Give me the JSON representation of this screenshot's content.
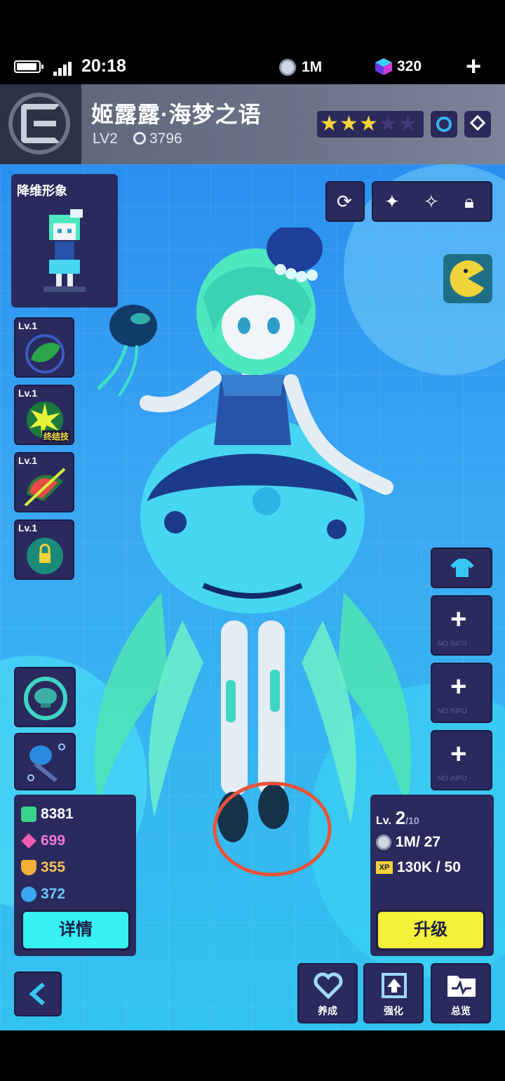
{
  "status_bar": {
    "time": "20:18",
    "coins": "1M",
    "gems": "320",
    "add_symbol": "+"
  },
  "header": {
    "character_name": "姬露露·海梦之语",
    "level": "LV2",
    "power": "3796",
    "stars_filled": 3,
    "stars_total": 5
  },
  "sprite_panel": {
    "label": "降维形象"
  },
  "skills": [
    {
      "level": "Lv.1",
      "badge": ""
    },
    {
      "level": "Lv.1",
      "badge": "终结技"
    },
    {
      "level": "Lv.1",
      "badge": ""
    },
    {
      "level": "Lv.1",
      "badge": ""
    }
  ],
  "side_slots": [
    {
      "label": "NO INFO"
    },
    {
      "label": "NO INFO"
    },
    {
      "label": "NO INFO"
    }
  ],
  "stats": {
    "hp": "8381",
    "attack": "699",
    "defense": "355",
    "speed": "372",
    "details_label": "详情"
  },
  "level_panel": {
    "lv_prefix": "Lv.",
    "level": "2",
    "max_level": "/10",
    "coin_cost": "1M/ 27",
    "xp_cost": "130K / 50",
    "upgrade_label": "升级"
  },
  "bottom_buttons": [
    {
      "label": "养成",
      "icon": "heart-icon"
    },
    {
      "label": "强化",
      "icon": "chip-upgrade-icon"
    },
    {
      "label": "总览",
      "icon": "folder-pulse-icon"
    }
  ],
  "colors": {
    "panel": "#2a2a5e",
    "details_button": "#36f0f2",
    "upgrade_button": "#f4f138",
    "star_on": "#f6d43a"
  }
}
